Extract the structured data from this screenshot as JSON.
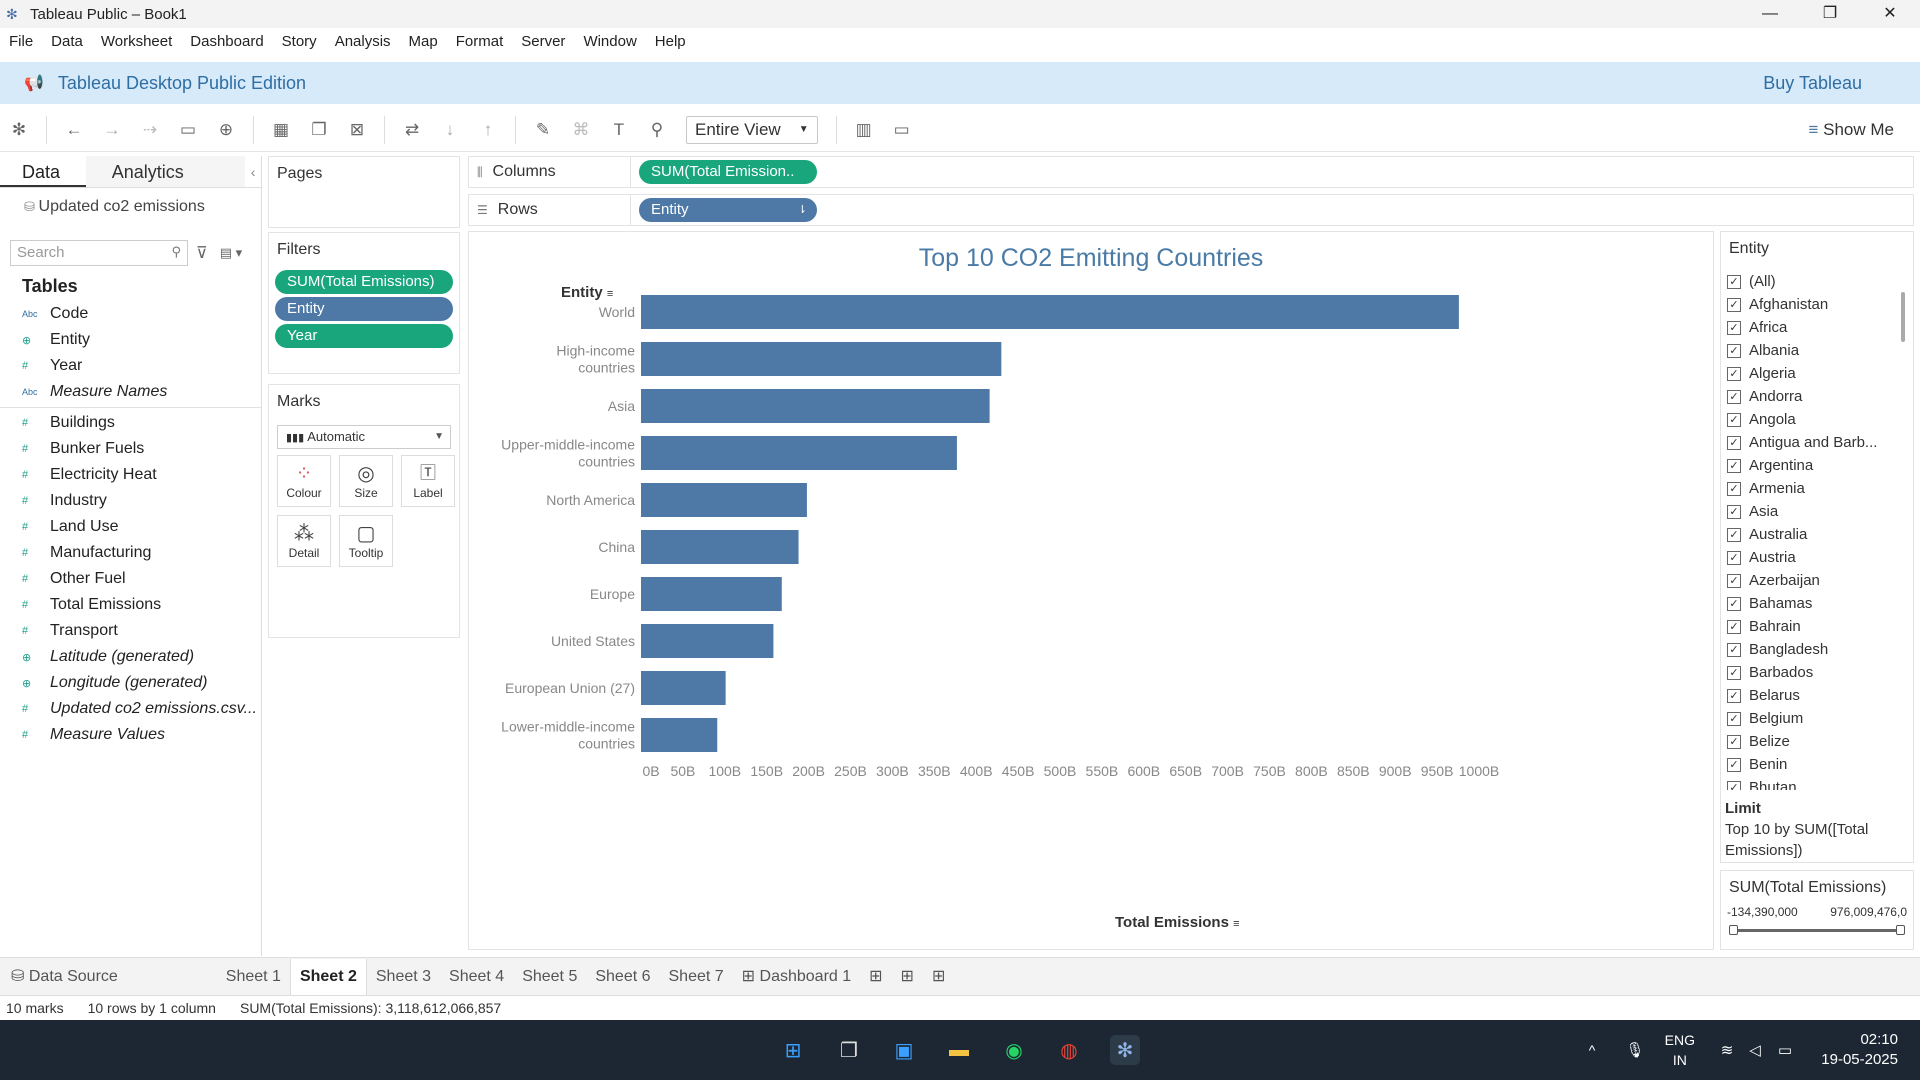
{
  "window": {
    "title": "Tableau Public – Book1",
    "controls": [
      "—",
      "❐",
      "✕"
    ]
  },
  "menu": [
    "File",
    "Data",
    "Worksheet",
    "Dashboard",
    "Story",
    "Analysis",
    "Map",
    "Format",
    "Server",
    "Window",
    "Help"
  ],
  "banner": {
    "edition": "Tableau Desktop Public Edition",
    "buy": "Buy Tableau"
  },
  "toolbar": {
    "fit": "Entire View",
    "show_me": "Show Me"
  },
  "data_pane": {
    "tab_data": "Data",
    "tab_analytics": "Analytics",
    "datasource": "Updated co2 emissions",
    "search_placeholder": "Search",
    "tables_heading": "Tables",
    "dimensions": [
      {
        "type": "Abc",
        "name": "Code"
      },
      {
        "type": "globe",
        "name": "Entity"
      },
      {
        "type": "#",
        "name": "Year"
      },
      {
        "type": "Abc",
        "name": "Measure Names",
        "italic": true
      }
    ],
    "measures": [
      {
        "type": "#",
        "name": "Buildings"
      },
      {
        "type": "#",
        "name": "Bunker Fuels"
      },
      {
        "type": "#",
        "name": "Electricity Heat"
      },
      {
        "type": "#",
        "name": "Industry"
      },
      {
        "type": "#",
        "name": "Land Use"
      },
      {
        "type": "#",
        "name": "Manufacturing"
      },
      {
        "type": "#",
        "name": "Other Fuel"
      },
      {
        "type": "#",
        "name": "Total Emissions"
      },
      {
        "type": "#",
        "name": "Transport"
      },
      {
        "type": "globe",
        "name": "Latitude (generated)",
        "italic": true
      },
      {
        "type": "globe",
        "name": "Longitude (generated)",
        "italic": true
      },
      {
        "type": "#",
        "name": "Updated co2 emissions.csv...",
        "italic": true
      },
      {
        "type": "#",
        "name": "Measure Values",
        "italic": true
      }
    ]
  },
  "pages": {
    "title": "Pages"
  },
  "filters": {
    "title": "Filters",
    "pills": [
      {
        "label": "SUM(Total Emissions)",
        "color": "#1aa67d"
      },
      {
        "label": "Entity",
        "color": "#4e79a7"
      },
      {
        "label": "Year",
        "color": "#1aa67d"
      }
    ]
  },
  "marks": {
    "title": "Marks",
    "type": "Automatic",
    "buttons": [
      {
        "label": "Colour",
        "icon": "color-dots-icon"
      },
      {
        "label": "Size",
        "icon": "size-icon"
      },
      {
        "label": "Label",
        "icon": "label-icon"
      },
      {
        "label": "Detail",
        "icon": "detail-icon"
      },
      {
        "label": "Tooltip",
        "icon": "tooltip-icon"
      }
    ]
  },
  "shelves": {
    "columns_label": "Columns",
    "columns_pill": "SUM(Total Emission..",
    "rows_label": "Rows",
    "rows_pill": "Entity"
  },
  "chart_data": {
    "type": "bar",
    "orientation": "horizontal",
    "title": "Top 10 CO2 Emitting Countries",
    "ylabel": "Entity",
    "xlabel": "Total Emissions",
    "categories": [
      "World",
      "High-income countries",
      "Asia",
      "Upper-middle-income countries",
      "North America",
      "China",
      "Europe",
      "United States",
      "European Union (27)",
      "Lower-middle-income countries"
    ],
    "category_lines": [
      [
        "World"
      ],
      [
        "High-income",
        "countries"
      ],
      [
        "Asia"
      ],
      [
        "Upper-middle-income",
        "countries"
      ],
      [
        "North America"
      ],
      [
        "China"
      ],
      [
        "Europe"
      ],
      [
        "United States"
      ],
      [
        "European Union (27)"
      ],
      [
        "Lower-middle-income",
        "countries"
      ]
    ],
    "values": [
      976,
      430,
      416,
      377,
      198,
      188,
      168,
      158,
      101,
      91
    ],
    "value_unit": "B",
    "xlim": [
      0,
      1000
    ],
    "xticks": [
      "0B",
      "50B",
      "100B",
      "150B",
      "200B",
      "250B",
      "300B",
      "350B",
      "400B",
      "450B",
      "500B",
      "550B",
      "600B",
      "650B",
      "700B",
      "750B",
      "800B",
      "850B",
      "900B",
      "950B",
      "1000B"
    ],
    "bar_color": "#4e79a7",
    "grid": false
  },
  "entity_filter": {
    "title": "Entity",
    "items": [
      "(All)",
      "Afghanistan",
      "Africa",
      "Albania",
      "Algeria",
      "Andorra",
      "Angola",
      "Antigua and Barb...",
      "Argentina",
      "Armenia",
      "Asia",
      "Australia",
      "Austria",
      "Azerbaijan",
      "Bahamas",
      "Bahrain",
      "Bangladesh",
      "Barbados",
      "Belarus",
      "Belgium",
      "Belize",
      "Benin",
      "Bhutan"
    ],
    "limit_label": "Limit",
    "limit_text": "Top 10 by SUM([Total Emissions])"
  },
  "sum_filter": {
    "title": "SUM(Total Emissions)",
    "min": "-134,390,000",
    "max": "976,009,476,0"
  },
  "sheet_tabs": [
    "Data Source",
    "Sheet 1",
    "Sheet 2",
    "Sheet 3",
    "Sheet 4",
    "Sheet 5",
    "Sheet 6",
    "Sheet 7",
    "Dashboard 1"
  ],
  "active_sheet": "Sheet 2",
  "status": {
    "marks": "10 marks",
    "rowscols": "10 rows by 1 column",
    "sum": "SUM(Total Emissions): 3,118,612,066,857"
  },
  "taskbar": {
    "lang1": "ENG",
    "lang2": "IN",
    "time": "02:10",
    "date": "19-05-2025"
  }
}
